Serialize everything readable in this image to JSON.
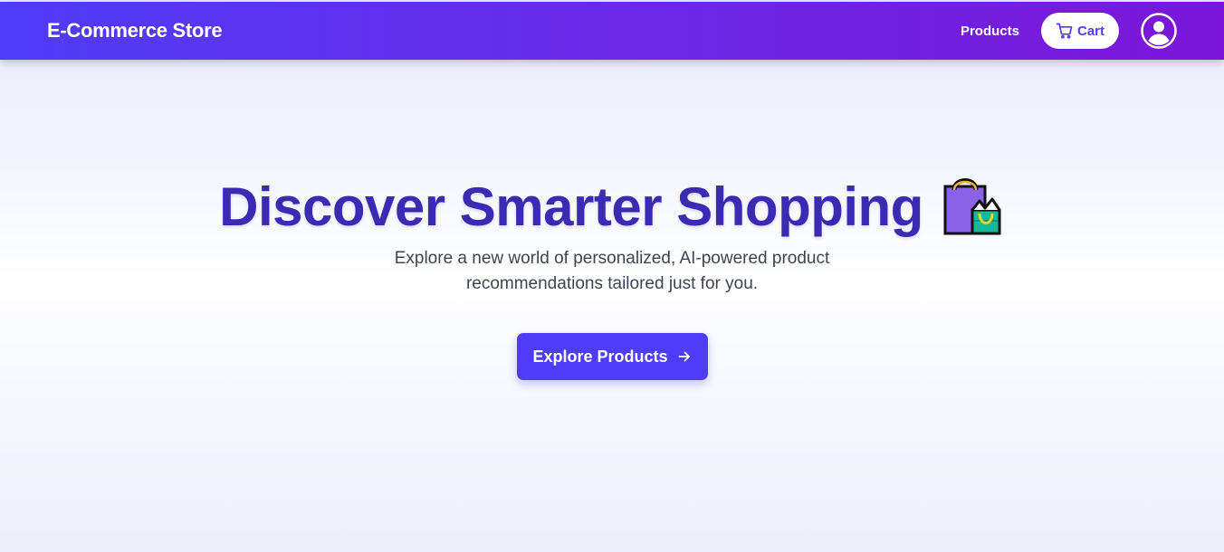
{
  "navbar": {
    "brand": "E-Commerce Store",
    "products_link": "Products",
    "cart_label": "Cart",
    "gradient_start": "#4f3cf7",
    "gradient_end": "#7b16d8",
    "icons": {
      "cart": "shopping-cart-icon",
      "profile": "user-circle-icon"
    }
  },
  "hero": {
    "title": "Discover Smarter Shopping",
    "title_icon": "shopping-bags-emoji",
    "subtitle": "Explore a new world of personalized, AI-powered product recommendations tailored just for you.",
    "cta_label": "Explore Products",
    "cta_icon": "arrow-right-icon",
    "accent_color": "#4f3cf7",
    "title_color": "#3b2bb3"
  }
}
